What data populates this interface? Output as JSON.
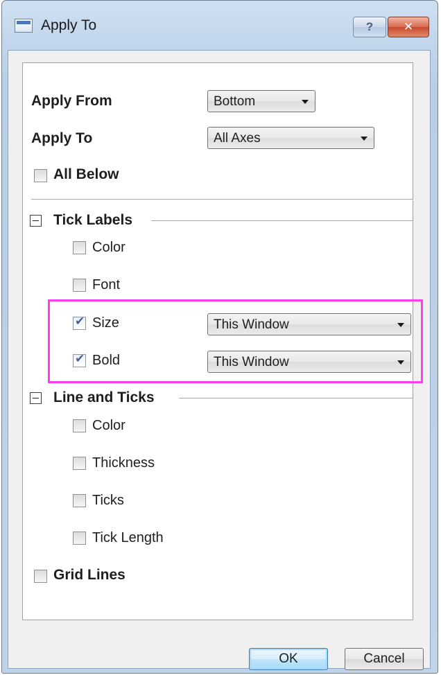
{
  "window": {
    "title": "Apply To",
    "help_label": "?",
    "close_label": "✕"
  },
  "form": {
    "apply_from_label": "Apply From",
    "apply_from_value": "Bottom",
    "apply_to_label": "Apply To",
    "apply_to_value": "All Axes",
    "all_below_label": "All Below",
    "all_below_checked": false
  },
  "tick_labels": {
    "heading": "Tick Labels",
    "color_label": "Color",
    "font_label": "Font",
    "size_label": "Size",
    "size_checked": true,
    "size_value": "This Window",
    "bold_label": "Bold",
    "bold_checked": true,
    "bold_value": "This Window"
  },
  "line_ticks": {
    "heading": "Line and Ticks",
    "color_label": "Color",
    "thickness_label": "Thickness",
    "ticks_label": "Ticks",
    "tick_length_label": "Tick Length"
  },
  "grid_lines_label": "Grid Lines",
  "buttons": {
    "ok_label": "OK",
    "cancel_label": "Cancel"
  },
  "colors": {
    "highlight": "#ff3df0",
    "titlebar": "#c2d6ec"
  }
}
